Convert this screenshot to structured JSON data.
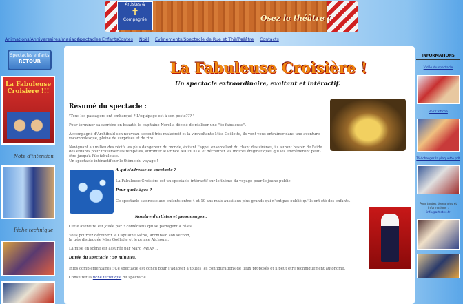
{
  "header": {
    "logo_line1": "Artistes &",
    "logo_line2": "Compagnie",
    "slogan": "Osez le théâtre !"
  },
  "nav": [
    "Animations/Anniversaires/mariages",
    "Spectacles Enfants",
    "Contes",
    "Noël",
    "Evènements/Spectacle de Rue et Thèmes",
    "Théâtre",
    "Contacts"
  ],
  "left": {
    "retour_top": "Spectacles enfants",
    "retour_label": "RETOUR",
    "poster_title": "La Fabuleuse Croisière !!!",
    "note_label": "Note d'intention",
    "fiche_label": "Fiche technique"
  },
  "main": {
    "title": "La Fabuleuse Croisière !",
    "subtitle": "Un spectacle extraordinaire, exaltant et intéractif.",
    "resume_heading": "Résumé du spectacle :",
    "p1": "\"Tous les passagers ont embarqué ? L'équipage est à son poste??? \"",
    "p2": "Pour terminer sa carrière en beauté, le capitaine Nérol a décidé de réaliser une \"ôe fabuleuse\".",
    "p3": "Accompagné d'Archibald son nouveau second très maladroit et la virevoltante Miss Goëlette, ils vont vous entraîner dans une aventure rocambolesque, pleine de surprises et de rire.",
    "p4": "Naviguant au milieu des récifs les plus dangereux du monde, évitant l'appel ensorcelant du chant des sirènes, ils auront besoin de l'aide des enfants pour traverser les tempêtes, affronter le Prince ATCHOUM et déchiffrer les indices énigmatiques qui les emmèneront peut-être jusqu'à l'île fabuleuse.",
    "p5": "Un spectacle intéractif sur le thème du voyage !",
    "q1": "A qui s'adresse ce spectacle ?",
    "a1": "La Fabuleuse Croisière est un spectacle intéractif sur le thème du voyage pour le jeune public.",
    "q2": "Pour quels âges ?",
    "a2": "Ce spectacle s'adresse aux enfants entre 4 et 10 ans mais aussi aux plus grands qui n'ont pas oublié qu'ils ont été des enfants.",
    "artists_heading": "Nombre d'artistes et personnages :",
    "a3": "Cette aventure est jouée par 3 comédiens qui se partagent 4 rôles.",
    "a4a": "Vous pourrez découvrir le Capitaine Nérol, Archibald son second,",
    "a4b": "la très distinguée Miss Goëlette et le prince Atchoum.",
    "a5": "La mise en scène est assurée par Marc PAYANT.",
    "duration_label": "Durée du spectacle :",
    "duration_value": "50 minutes.",
    "a6": "Infos complémentaires : Ce spectacle est conçu pour s'adapter à toutes les configurations de lieux proposés et il peut être techniquement autonome.",
    "a7_prefix": "Consultez la",
    "a7_link": "fiche technique",
    "a7_suffix": "du spectacle."
  },
  "right": {
    "heading": "INFORMATIONS",
    "link1": "Vidéo du spectacle",
    "link2": "Voir l'affiche",
    "link3": "Télécharger la plaquette pdf",
    "info_text": "Pour toutes demandes et informations :",
    "info_email": "info@artistes.fr"
  }
}
